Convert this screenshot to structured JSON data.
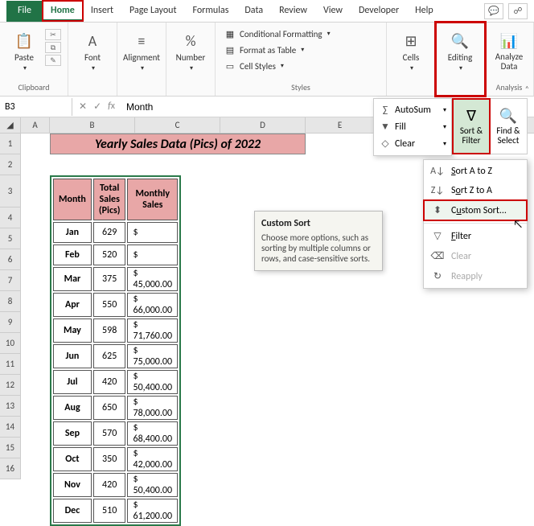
{
  "tabs": {
    "file": "File",
    "home": "Home",
    "insert": "Insert",
    "pagelayout": "Page Layout",
    "formulas": "Formulas",
    "data": "Data",
    "review": "Review",
    "view": "View",
    "developer": "Developer",
    "help": "Help"
  },
  "ribbon": {
    "clipboard": {
      "paste": "Paste",
      "label": "Clipboard"
    },
    "font": {
      "btn": "Font"
    },
    "alignment": {
      "btn": "Alignment"
    },
    "number": {
      "btn": "Number"
    },
    "styles": {
      "cond_fmt": "Conditional Formatting",
      "as_table": "Format as Table",
      "cell_styles": "Cell Styles",
      "label": "Styles"
    },
    "cells": {
      "btn": "Cells"
    },
    "editing": {
      "btn": "Editing"
    },
    "analysis": {
      "btn": "Analyze Data",
      "label": "Analysis"
    }
  },
  "formula_bar": {
    "namebox": "B3",
    "value": "Month"
  },
  "columns": [
    "A",
    "B",
    "C",
    "D",
    "E"
  ],
  "rows": [
    "1",
    "2",
    "3",
    "4",
    "5",
    "6",
    "7",
    "8",
    "9",
    "10",
    "11",
    "12",
    "13",
    "14",
    "15",
    "16"
  ],
  "title": "Yearly Sales Data (Pics) of 2022",
  "headers": {
    "month": "Month",
    "total": "Total Sales (Pics)",
    "sales": "Monthly Sales"
  },
  "data_rows": [
    {
      "m": "Jan",
      "t": "629",
      "s": ""
    },
    {
      "m": "Feb",
      "t": "520",
      "s": ""
    },
    {
      "m": "Mar",
      "t": "375",
      "s": "45,000.00"
    },
    {
      "m": "Apr",
      "t": "550",
      "s": "66,000.00"
    },
    {
      "m": "May",
      "t": "598",
      "s": "71,760.00"
    },
    {
      "m": "Jun",
      "t": "625",
      "s": "75,000.00"
    },
    {
      "m": "Jul",
      "t": "420",
      "s": "50,400.00"
    },
    {
      "m": "Aug",
      "t": "650",
      "s": "78,000.00"
    },
    {
      "m": "Sep",
      "t": "570",
      "s": "68,400.00"
    },
    {
      "m": "Oct",
      "t": "350",
      "s": "42,000.00"
    },
    {
      "m": "Nov",
      "t": "420",
      "s": "50,400.00"
    },
    {
      "m": "Dec",
      "t": "510",
      "s": "61,200.00"
    }
  ],
  "dollar": "$",
  "autosum": {
    "sum": "AutoSum",
    "fill": "Fill",
    "clear": "Clear"
  },
  "sf": {
    "sort": "Sort & Filter",
    "find": "Find & Select"
  },
  "sort_menu": {
    "az": "Sort A to Z",
    "za": "Sort Z to A",
    "custom": "Custom Sort...",
    "filter": "Filter",
    "clear": "Clear",
    "reapply": "Reapply"
  },
  "tooltip": {
    "title": "Custom Sort",
    "body": "Choose more options, such as sorting by multiple columns or rows, and case-sensitive sorts."
  }
}
